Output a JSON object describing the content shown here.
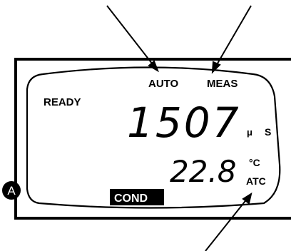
{
  "display": {
    "status": "READY",
    "mode_auto": "AUTO",
    "mode_meas": "MEAS",
    "reading_main": "1507",
    "unit_prefix": "μ",
    "unit_main": "S",
    "reading_temp": "22.8",
    "temp_unit": "°C",
    "atc": "ATC",
    "cond": "COND"
  },
  "callout": {
    "marker": "A"
  }
}
